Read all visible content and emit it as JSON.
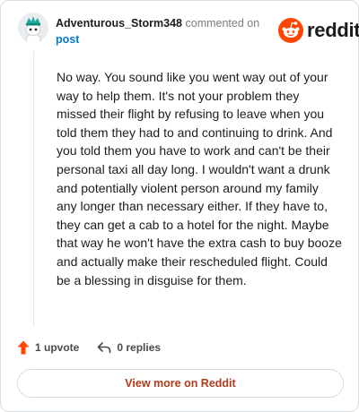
{
  "header": {
    "username": "Adventurous_Storm348",
    "commented_on": "commented on",
    "post_link": "post"
  },
  "brand": {
    "name": "reddit",
    "accent": "#ff4500"
  },
  "comment": {
    "body": "No way. You sound like you went way out of your way to help them. It's not your problem they missed their flight by refusing to leave when you told them they had to and continuing to drink. And you told them you have to work and can't be their personal taxi all day long. I wouldn't want a drunk and potentially violent person around my family any longer than necessary either. If they have to, they can get a cab to a hotel for the night. Maybe that way he won't have the extra cash to buy booze and actually make their rescheduled flight. Could be a blessing in disguise for them."
  },
  "actions": {
    "upvote_label": "1 upvote",
    "upvote_icon": "upvote-arrow-icon",
    "upvote_color": "#ff4500",
    "reply_label": "0 replies",
    "reply_icon": "reply-arrow-icon"
  },
  "footer": {
    "view_more_label": "View more on Reddit"
  }
}
